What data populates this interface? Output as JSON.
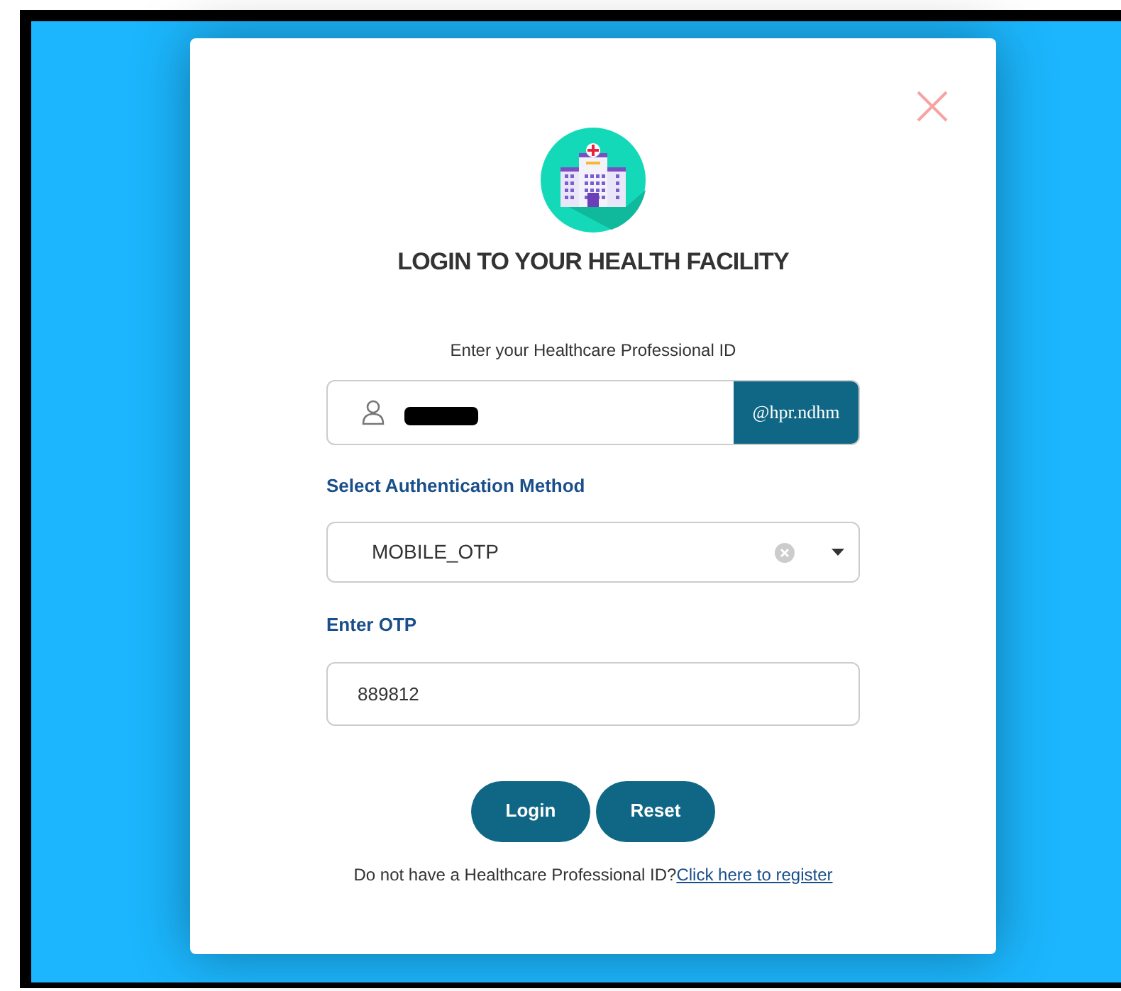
{
  "dialog": {
    "title": "LOGIN TO YOUR HEALTH FACILITY"
  },
  "id_field": {
    "label": "Enter your Healthcare Professional ID",
    "suffix": "@hpr.ndhm"
  },
  "auth_method": {
    "label": "Select Authentication Method",
    "value": "MOBILE_OTP"
  },
  "otp_field": {
    "label": "Enter OTP",
    "value": "889812"
  },
  "buttons": [
    "Login",
    "Reset"
  ],
  "footer": {
    "text": "Do not have a Healthcare Professional ID?",
    "link": "Click here to register"
  }
}
